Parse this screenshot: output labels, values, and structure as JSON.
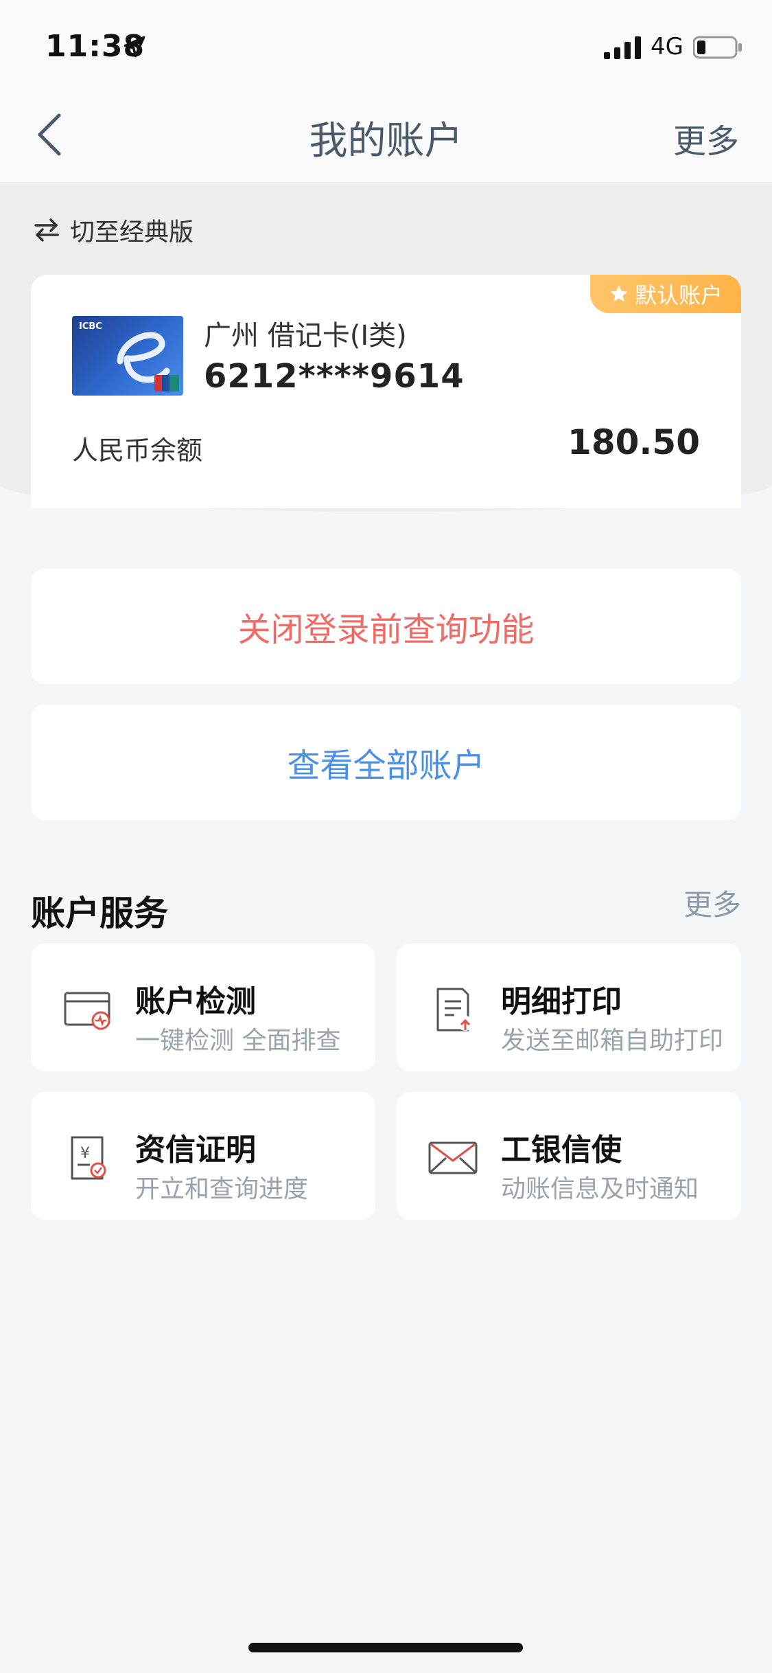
{
  "status": {
    "time": "11:38",
    "network": "4G"
  },
  "nav": {
    "title": "我的账户",
    "more": "更多"
  },
  "switch": {
    "label": "切至经典版"
  },
  "account": {
    "badge": "默认账户",
    "type": "广州 借记卡(Ⅰ类)",
    "number": "6212****9614",
    "balance_label": "人民币余额",
    "balance": "180.50"
  },
  "actions": {
    "close_query": "关闭登录前查询功能",
    "view_all": "查看全部账户"
  },
  "services": {
    "title": "账户服务",
    "more": "更多",
    "items": [
      {
        "title": "账户检测",
        "subtitle": "一键检测 全面排查",
        "icon": "account-check-icon"
      },
      {
        "title": "明细打印",
        "subtitle": "发送至邮箱自助打印",
        "icon": "print-detail-icon"
      },
      {
        "title": "资信证明",
        "subtitle": "开立和查询进度",
        "icon": "credit-certificate-icon"
      },
      {
        "title": "工银信使",
        "subtitle": "动账信息及时通知",
        "icon": "envelope-icon"
      }
    ]
  },
  "colors": {
    "accent_red": "#f06a66",
    "accent_blue": "#4a8fe8",
    "badge": "#ffb347"
  }
}
